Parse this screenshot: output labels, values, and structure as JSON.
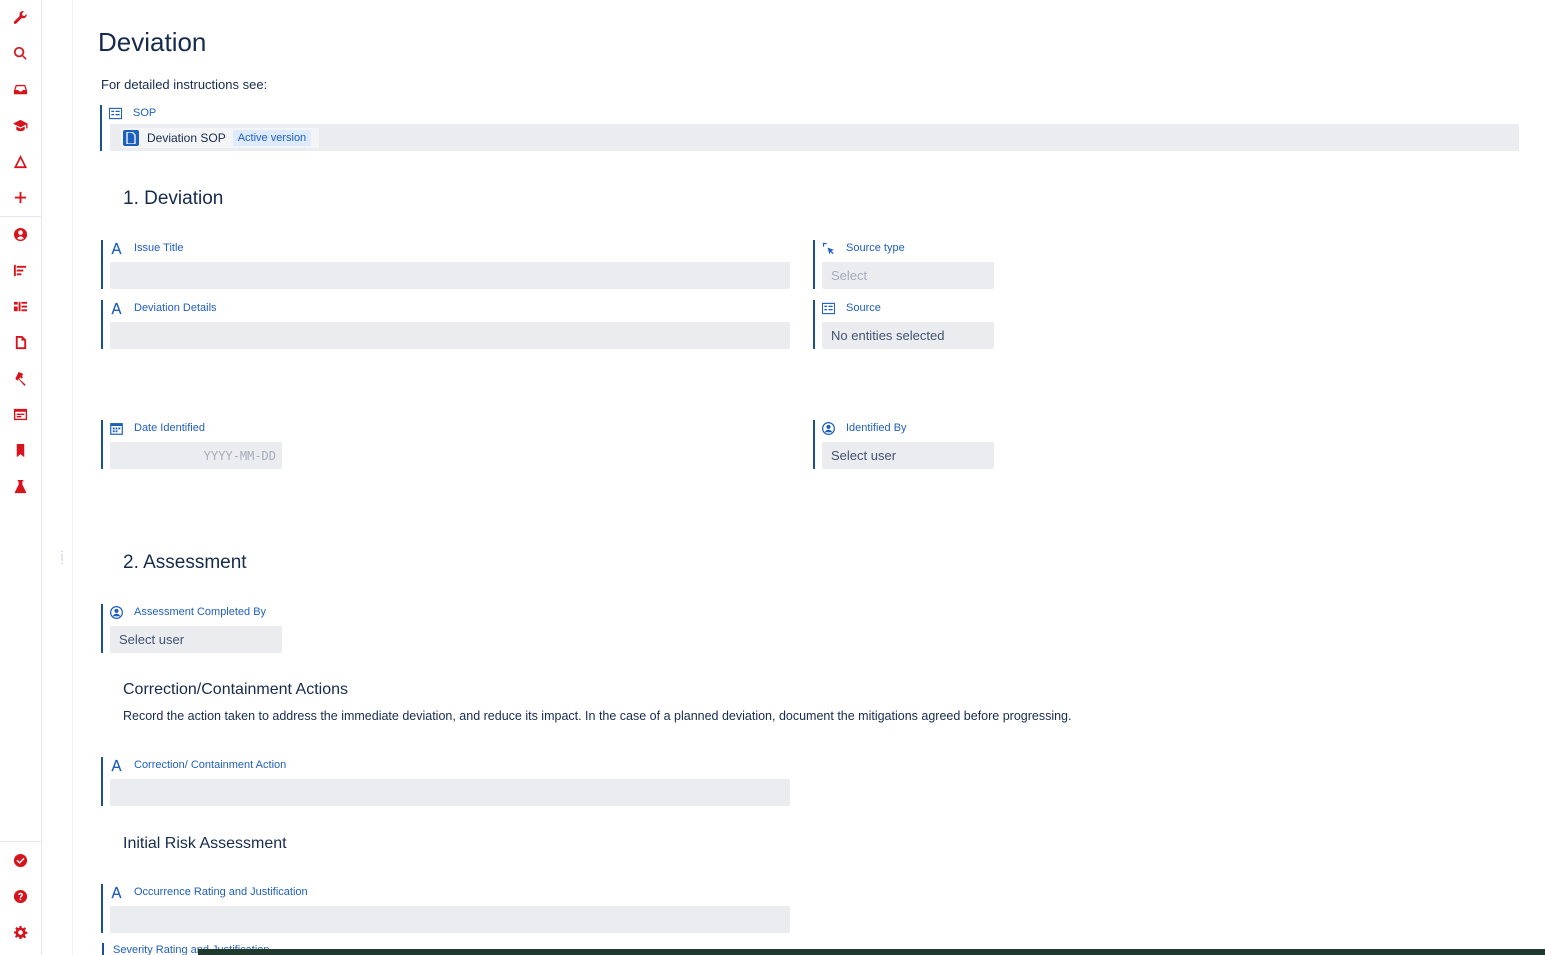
{
  "colors": {
    "accent": "#1f5fbd",
    "sidebar_icon": "#d7141d",
    "field_bg": "#ebecf0"
  },
  "sidebar": {
    "top_icons": [
      "wrench-icon",
      "search-icon",
      "inbox-icon",
      "graduation-cap-icon",
      "triangle-icon",
      "plus-icon"
    ],
    "middle_icons": [
      "user-circle-icon",
      "gantt-icon",
      "board-icon",
      "document-icon",
      "hammer-icon",
      "browser-icon",
      "bookmark-icon",
      "flask-icon"
    ],
    "bottom_icons": [
      "check-circle-icon",
      "help-icon",
      "gear-icon"
    ]
  },
  "page": {
    "title": "Deviation",
    "instructions": "For detailed instructions see:",
    "sop": {
      "label": "SOP",
      "doc_name": "Deviation SOP",
      "badge": "Active version"
    }
  },
  "section1": {
    "heading": "1. Deviation",
    "issue_title": {
      "label": "Issue Title",
      "value": ""
    },
    "deviation_details": {
      "label": "Deviation Details",
      "value": ""
    },
    "source_type": {
      "label": "Source type",
      "placeholder": "Select"
    },
    "source": {
      "label": "Source",
      "value": "No entities selected"
    },
    "date_identified": {
      "label": "Date Identified",
      "placeholder": "YYYY-MM-DD"
    },
    "identified_by": {
      "label": "Identified By",
      "value": "Select user"
    }
  },
  "section2": {
    "heading": "2. Assessment",
    "assessment_completed_by": {
      "label": "Assessment Completed By",
      "value": "Select user"
    },
    "correction": {
      "heading": "Correction/Containment Actions",
      "description": "Record the action taken to address the immediate deviation, and reduce its impact. In the case of a planned deviation, document the mitigations agreed before progressing.",
      "field_label": "Correction/ Containment Action"
    },
    "risk": {
      "heading": "Initial Risk Assessment",
      "occurrence_label": "Occurrence Rating and Justification",
      "severity_label": "Severity Rating and Justification"
    }
  }
}
